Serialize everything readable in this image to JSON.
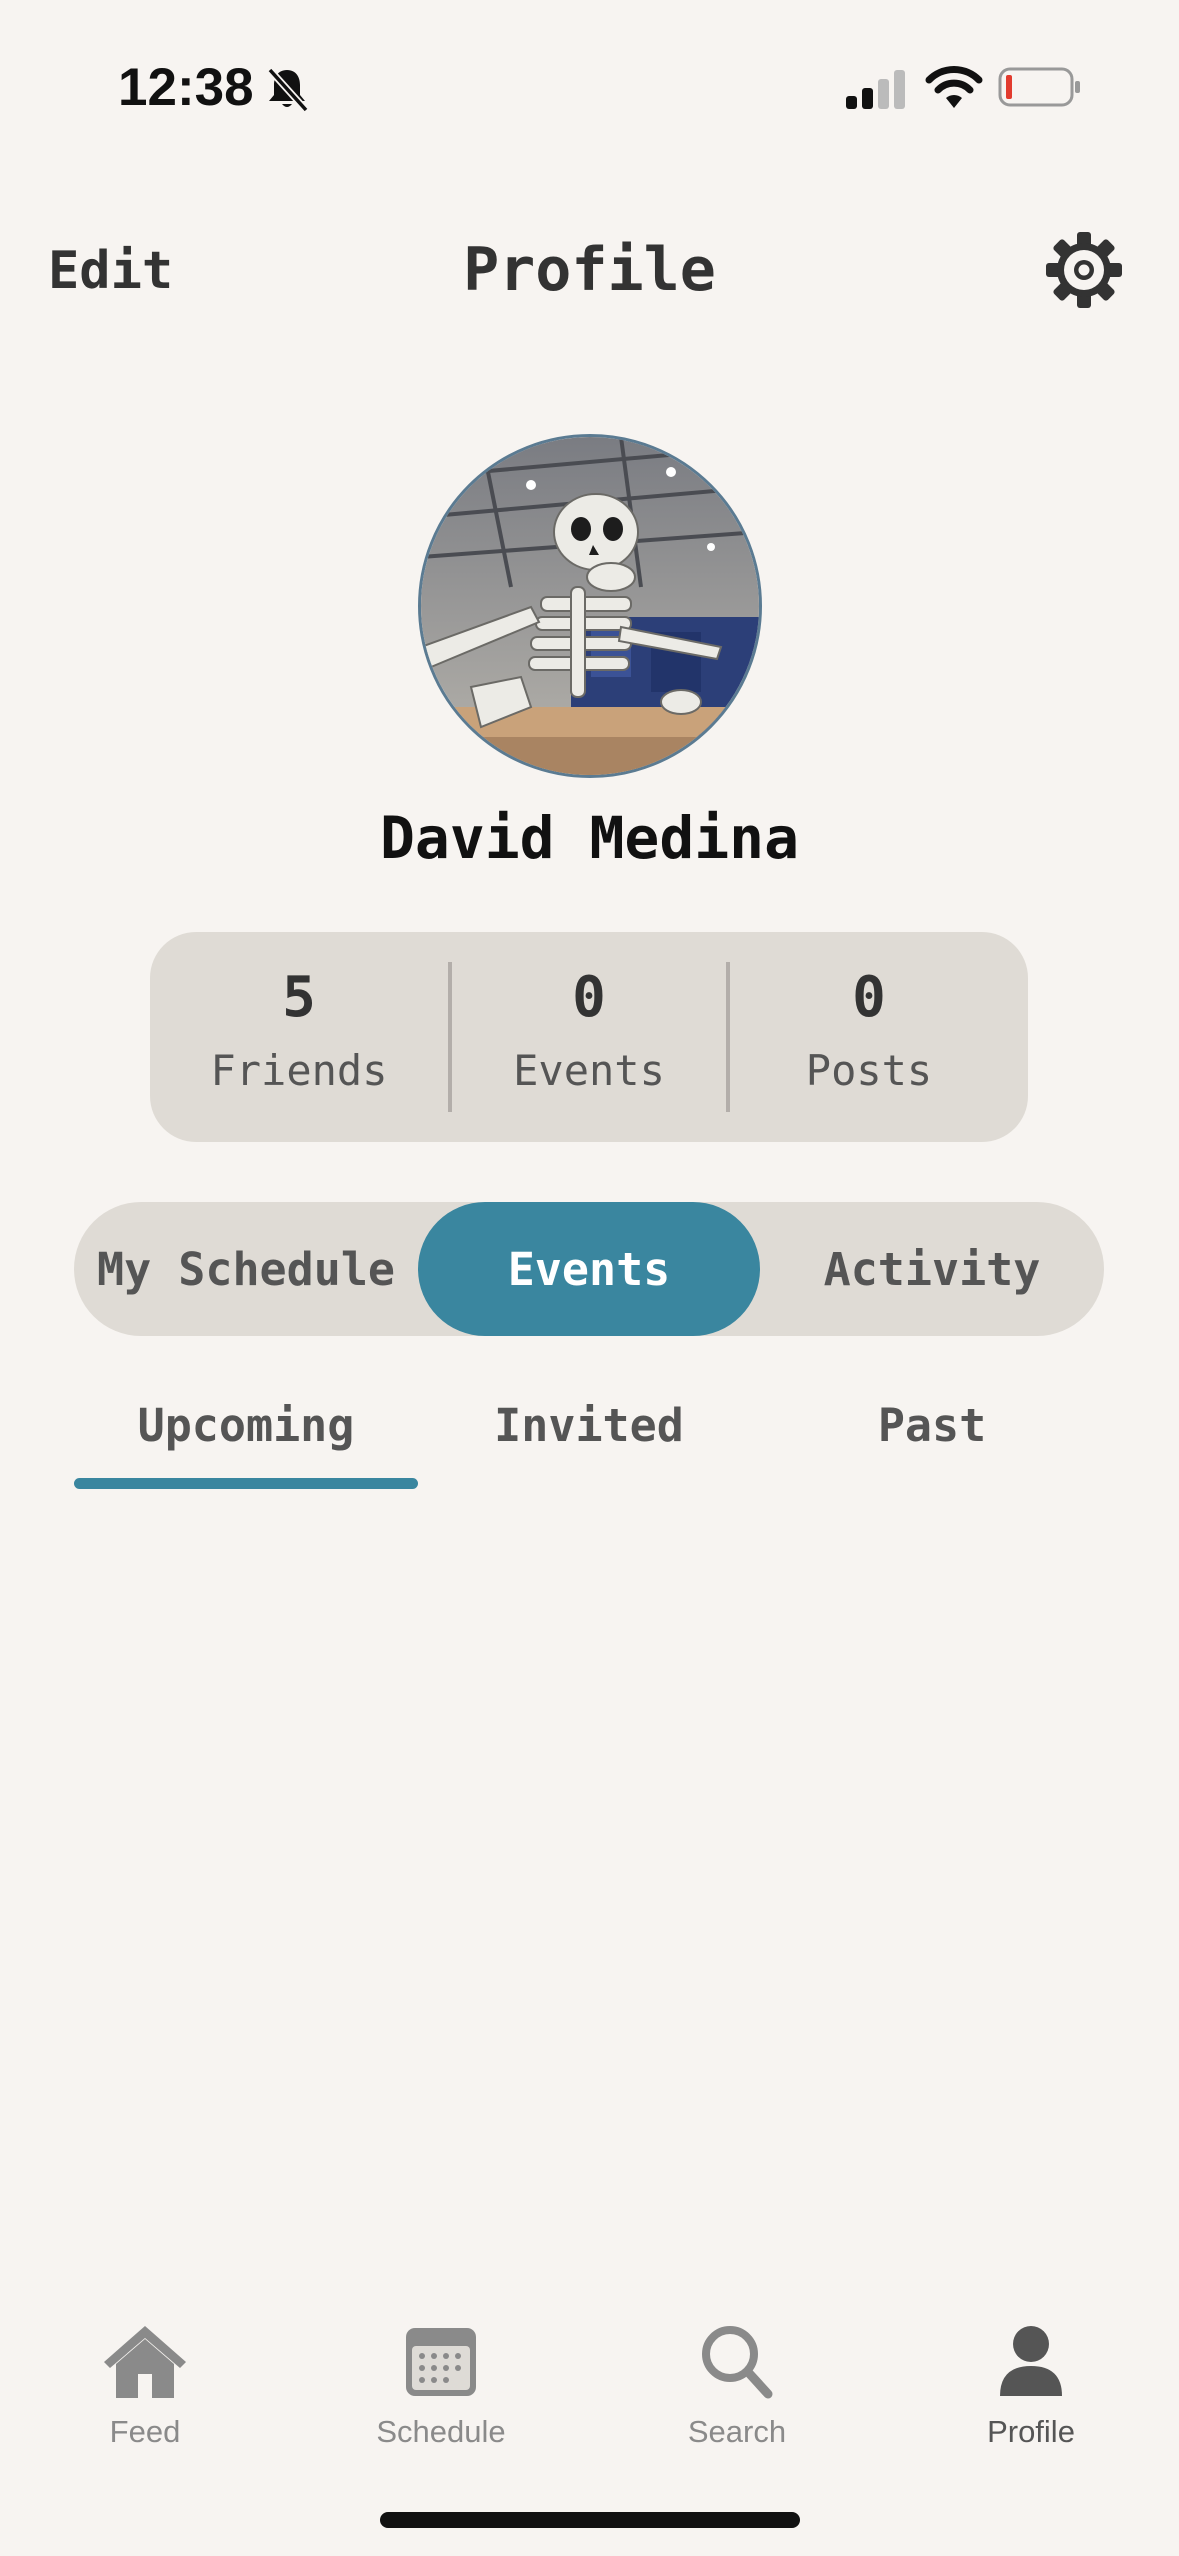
{
  "status_bar": {
    "time": "12:38",
    "icons": [
      "bell-slash-icon",
      "cellular-signal-icon",
      "wifi-icon",
      "battery-low-icon"
    ],
    "battery_color": "#e23b2e"
  },
  "header": {
    "edit_label": "Edit",
    "title": "Profile",
    "settings_icon": "gear-icon"
  },
  "profile": {
    "name": "David Medina",
    "avatar": "skeleton-photo"
  },
  "stats": [
    {
      "value": "5",
      "label": "Friends"
    },
    {
      "value": "0",
      "label": "Events"
    },
    {
      "value": "0",
      "label": "Posts"
    }
  ],
  "segments": [
    {
      "label": "My Schedule",
      "active": false
    },
    {
      "label": "Events",
      "active": true
    },
    {
      "label": "Activity",
      "active": false
    }
  ],
  "subtabs": [
    {
      "label": "Upcoming",
      "active": true
    },
    {
      "label": "Invited",
      "active": false
    },
    {
      "label": "Past",
      "active": false
    }
  ],
  "tab_bar": [
    {
      "label": "Feed",
      "icon": "home-icon",
      "active": false
    },
    {
      "label": "Schedule",
      "icon": "calendar-icon",
      "active": false
    },
    {
      "label": "Search",
      "icon": "search-icon",
      "active": false
    },
    {
      "label": "Profile",
      "icon": "person-icon",
      "active": true
    }
  ],
  "colors": {
    "accent": "#3a869f",
    "background": "#f7f4f1",
    "panel": "#dfdbd5"
  }
}
